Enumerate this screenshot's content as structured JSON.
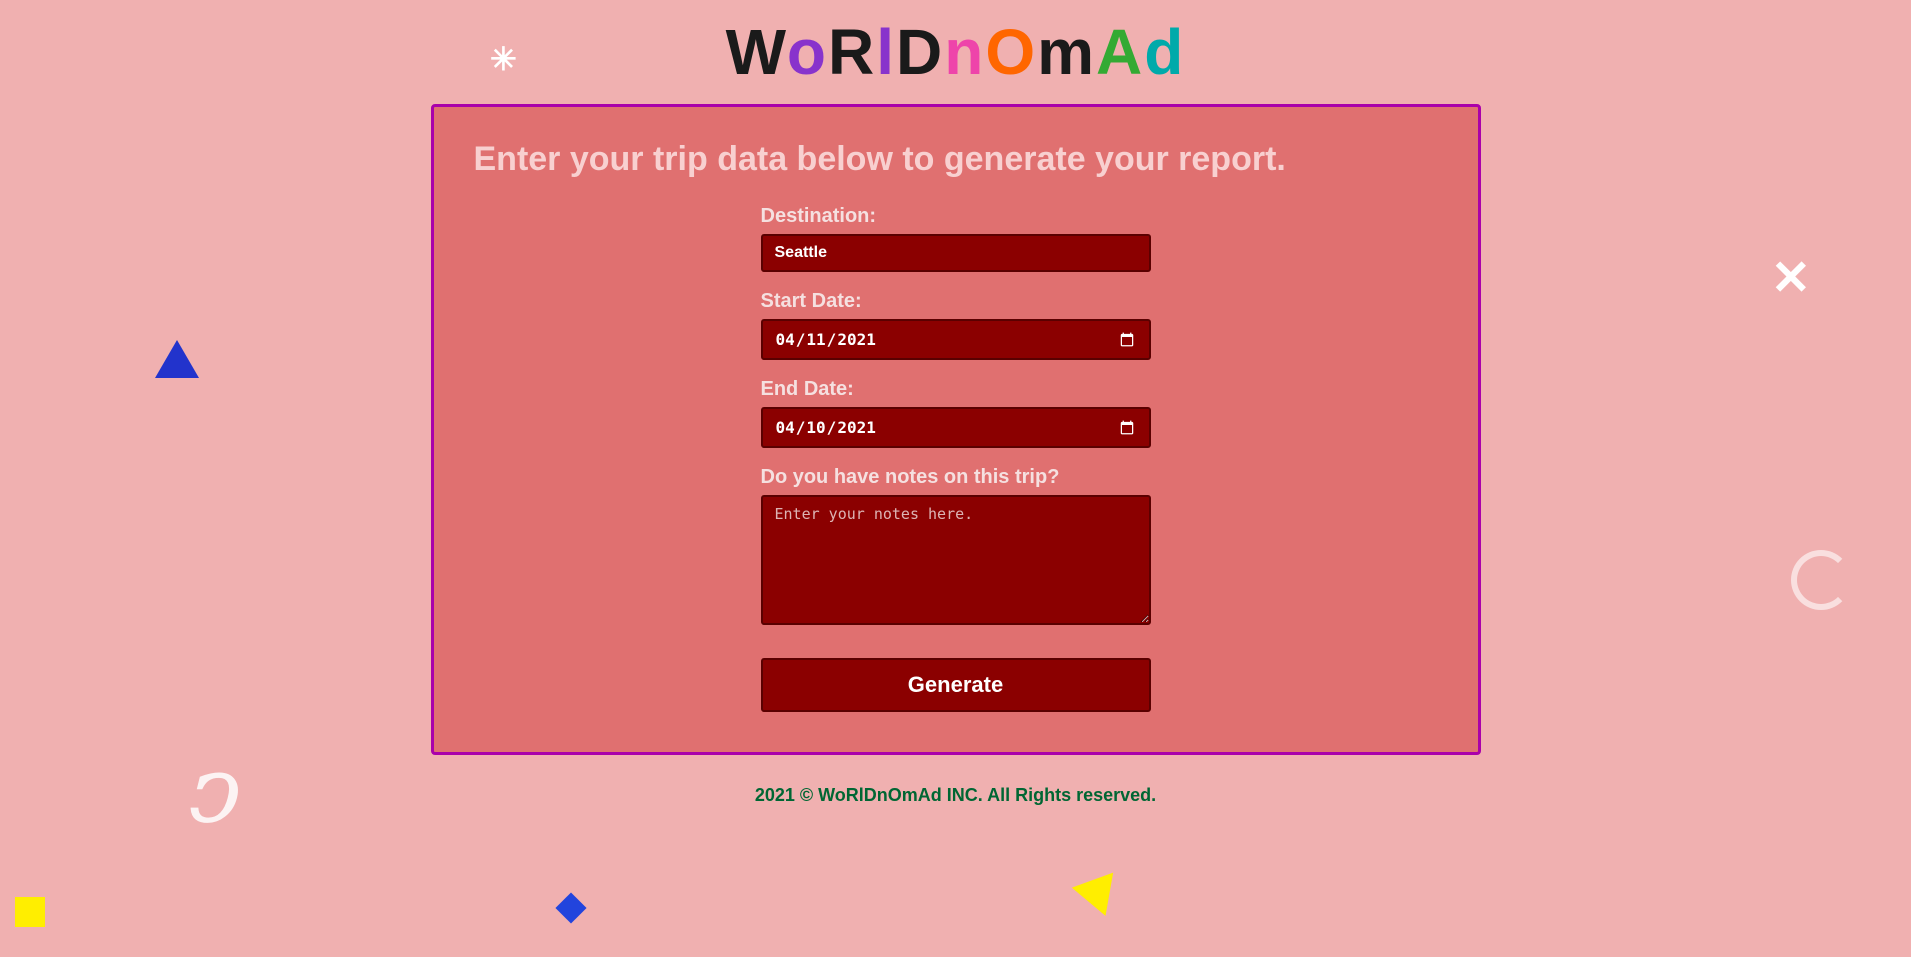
{
  "header": {
    "title_parts": [
      {
        "text": "W",
        "color": "black"
      },
      {
        "text": "o",
        "color": "purple"
      },
      {
        "text": "R",
        "color": "black"
      },
      {
        "text": "l",
        "color": "purple"
      },
      {
        "text": "D",
        "color": "black"
      },
      {
        "text": "n",
        "color": "pink"
      },
      {
        "text": "O",
        "color": "orange"
      },
      {
        "text": "m",
        "color": "black"
      },
      {
        "text": "A",
        "color": "green"
      },
      {
        "text": "d",
        "color": "teal"
      }
    ],
    "title_full": "WoRlDnOmAd"
  },
  "card": {
    "heading": "Enter your trip data below to generate your report.",
    "destination_label": "Destination:",
    "destination_value": "Seattle",
    "start_date_label": "Start Date:",
    "start_date_value": "2021-04-11",
    "end_date_label": "End Date:",
    "end_date_value": "2021-04-10",
    "notes_label": "Do you have notes on this trip?",
    "notes_placeholder": "Enter your notes here.",
    "generate_button": "Generate"
  },
  "footer": {
    "text": "2021 © WoRlDnOmAd INC. All Rights reserved."
  },
  "decorations": {
    "asterisk_left": "✳",
    "x_right": "✕",
    "spiral": "ℂ"
  }
}
